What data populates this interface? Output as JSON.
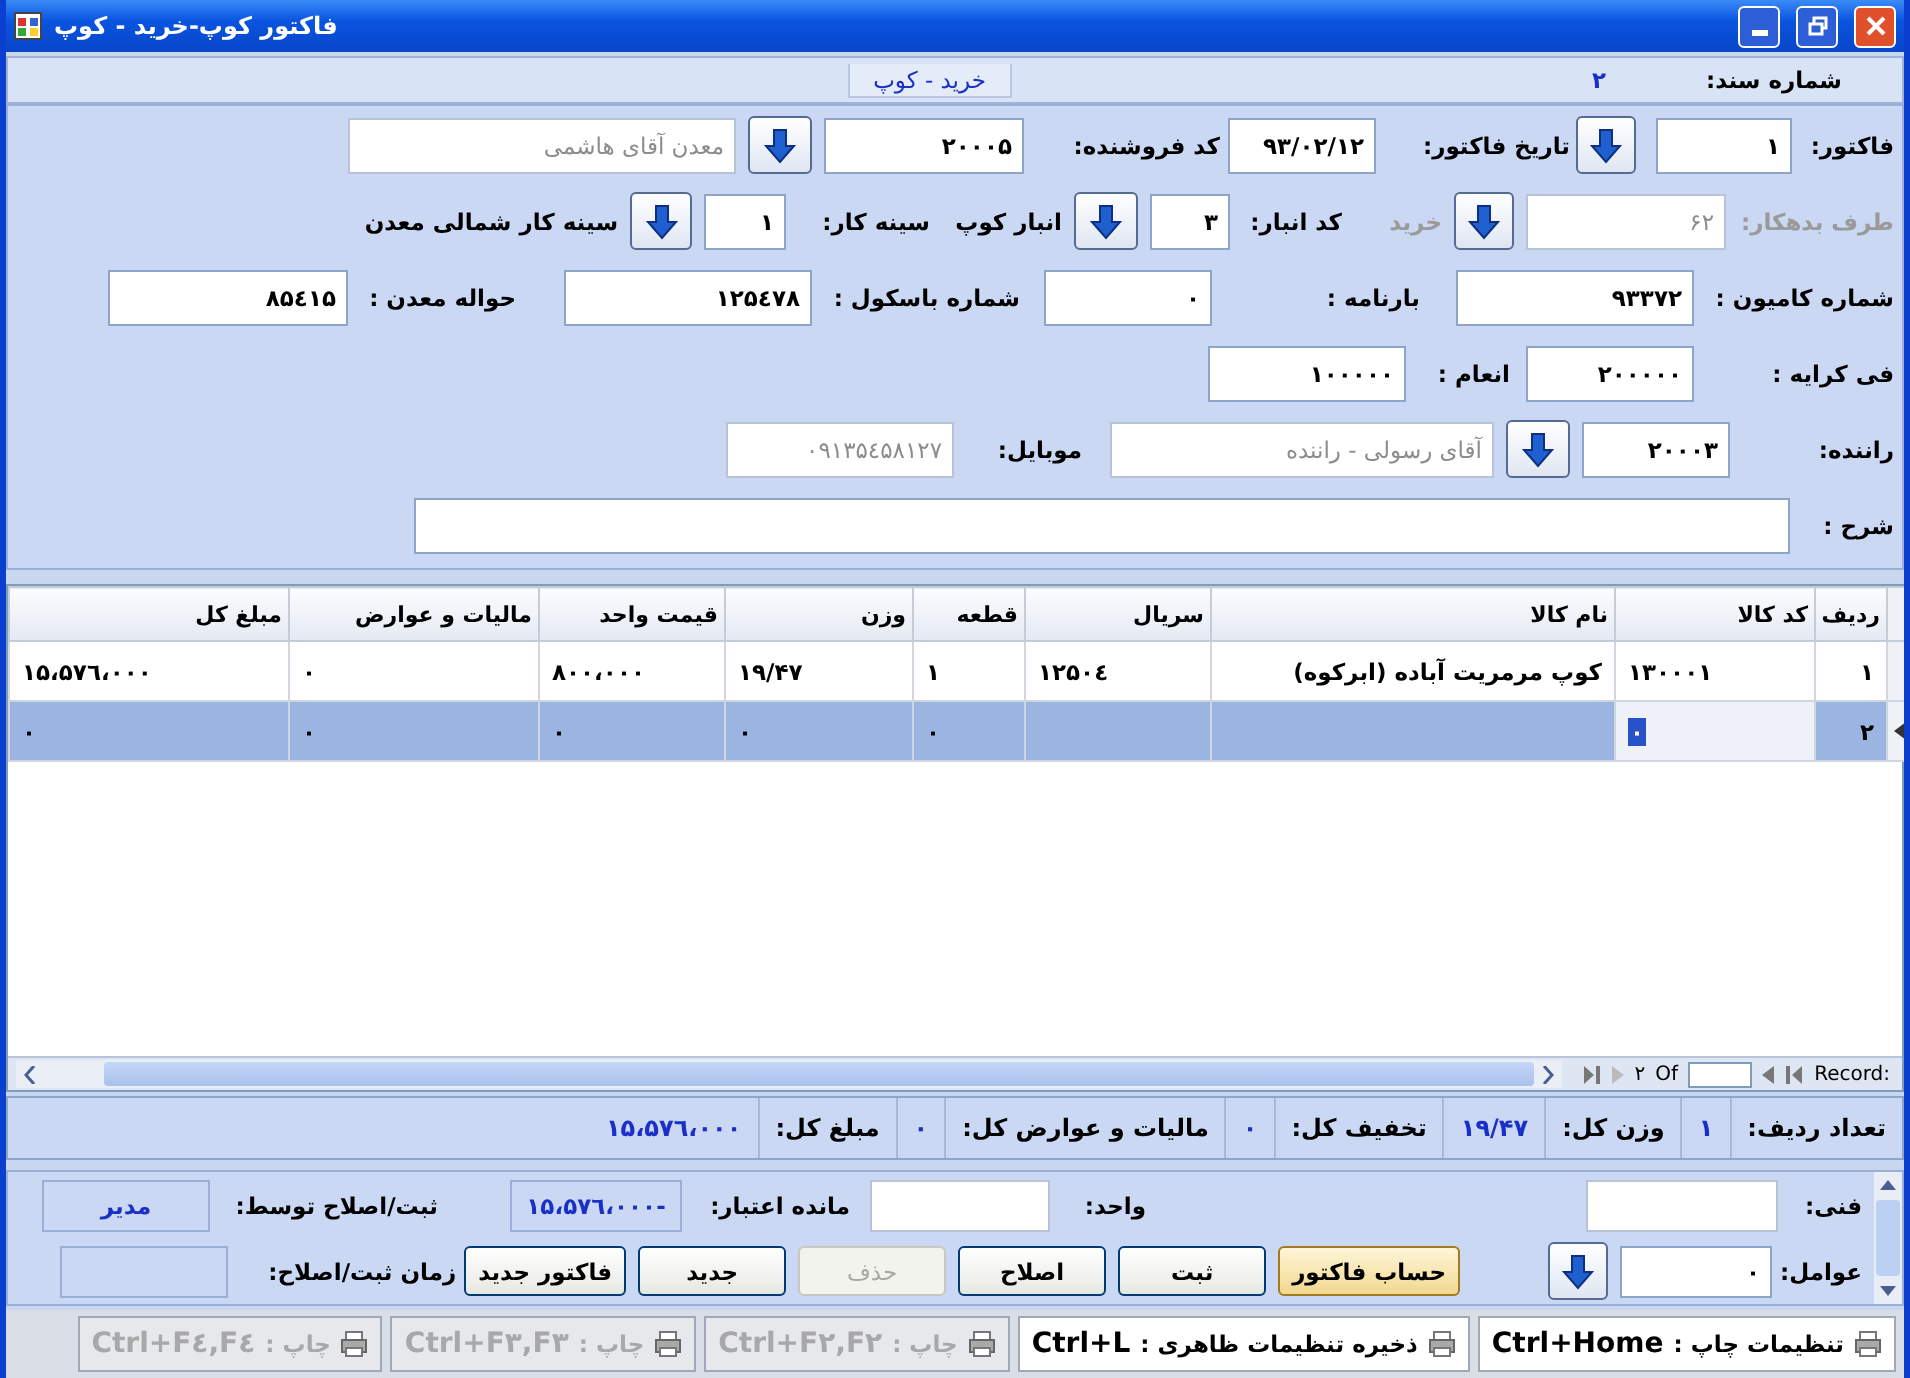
{
  "window": {
    "title": "فاکتور کوپ-خرید - کوپ"
  },
  "header": {
    "doc_label": "شماره سند:",
    "doc_number": "۲",
    "tab": "خرید - کوپ"
  },
  "form_rows": [
    [
      {
        "kind": "label",
        "text": "فاکتور:",
        "disabled": false
      },
      {
        "kind": "field",
        "value": "۱",
        "disabled": false
      },
      {
        "kind": "button"
      },
      {
        "kind": "label",
        "text": "تاریخ فاکتور:",
        "disabled": false
      },
      {
        "kind": "field",
        "value": "۹۳/۰۲/۱۲",
        "disabled": false
      },
      {
        "kind": "label",
        "text": "کد فروشنده:",
        "disabled": false
      },
      {
        "kind": "field",
        "value": "۲۰۰۰۵",
        "disabled": false
      },
      {
        "kind": "button"
      },
      {
        "kind": "field",
        "value": "معدن آقای هاشمی",
        "disabled": true
      }
    ],
    [
      {
        "kind": "label",
        "text": "طرف بدهکار:",
        "disabled": true
      },
      {
        "kind": "field",
        "value": "۶۲",
        "disabled": true
      },
      {
        "kind": "button"
      },
      {
        "kind": "label",
        "text": "خرید",
        "disabled": true
      },
      {
        "kind": "label",
        "text": "کد انبار:",
        "disabled": false
      },
      {
        "kind": "field",
        "value": "۳",
        "disabled": false
      },
      {
        "kind": "button"
      },
      {
        "kind": "label",
        "text": "انبار کوپ",
        "disabled": false
      },
      {
        "kind": "label",
        "text": "سینه کار:",
        "disabled": false
      },
      {
        "kind": "field",
        "value": "۱",
        "disabled": false
      },
      {
        "kind": "button"
      },
      {
        "kind": "label",
        "text": "سینه کار شمالی معدن",
        "disabled": false
      }
    ],
    [
      {
        "kind": "label",
        "text": "شماره کامیون :",
        "disabled": false
      },
      {
        "kind": "field",
        "value": "۹۳۳۷۲",
        "disabled": false
      },
      {
        "kind": "label",
        "text": "بارنامه :",
        "disabled": false
      },
      {
        "kind": "field",
        "value": "۰",
        "disabled": false
      },
      {
        "kind": "label",
        "text": "شماره باسکول :",
        "disabled": false
      },
      {
        "kind": "field",
        "value": "۱۲۵٤۷۸",
        "disabled": false
      },
      {
        "kind": "label",
        "text": "حواله معدن :",
        "disabled": false
      },
      {
        "kind": "field",
        "value": "۸۵٤۱۵",
        "disabled": false
      }
    ],
    [
      {
        "kind": "label",
        "text": "فی کرایه :",
        "disabled": false
      },
      {
        "kind": "field",
        "value": "۲۰۰۰۰۰",
        "disabled": false
      },
      {
        "kind": "label",
        "text": "انعام :",
        "disabled": false
      },
      {
        "kind": "field",
        "value": "۱۰۰۰۰۰",
        "disabled": false
      }
    ],
    [
      {
        "kind": "label",
        "text": "راننده:",
        "disabled": false
      },
      {
        "kind": "field",
        "value": "۲۰۰۰۳",
        "disabled": false
      },
      {
        "kind": "button"
      },
      {
        "kind": "field",
        "value": "آقای رسولی - راننده",
        "disabled": true
      },
      {
        "kind": "label",
        "text": "موبایل:",
        "disabled": false
      },
      {
        "kind": "field",
        "value": "۰۹۱۳۵٤۵۸۱۲۷",
        "disabled": true
      }
    ],
    [
      {
        "kind": "label",
        "text": "شرح :",
        "disabled": false
      },
      {
        "kind": "field",
        "disabled": false
      }
    ]
  ],
  "table": {
    "columns": [
      "ردیف",
      "کد کالا",
      "نام کالا",
      "سریال",
      "قطعه",
      "وزن",
      "قیمت واحد",
      "مالیات و عوارض",
      "مبلغ کل"
    ],
    "rows": [
      {
        "selected": false,
        "cells": [
          {
            "text": "۱",
            "focused": false
          },
          {
            "text": "۱۳۰۰۰۱",
            "focused": false
          },
          {
            "text": "کوپ مرمریت آباده (ابرکوه)",
            "focused": false
          },
          {
            "text": "۱۲۵۰٤",
            "focused": false
          },
          {
            "text": "۱",
            "focused": false
          },
          {
            "text": "۱۹/۴۷",
            "focused": false
          },
          {
            "text": "۸۰۰،۰۰۰",
            "focused": false
          },
          {
            "text": "۰",
            "focused": false
          },
          {
            "text": "۱۵،۵۷٦،۰۰۰",
            "focused": false
          }
        ]
      },
      {
        "selected": true,
        "cells": [
          {
            "text": "۲",
            "focused": false
          },
          {
            "text": "۰",
            "focused": true
          },
          {
            "focused": false
          },
          {
            "focused": false
          },
          {
            "text": "۰",
            "focused": false
          },
          {
            "text": "۰",
            "focused": false
          },
          {
            "text": "۰",
            "focused": false
          },
          {
            "text": "۰",
            "focused": false
          },
          {
            "text": "۰",
            "focused": false
          }
        ]
      }
    ]
  },
  "record_nav": {
    "label": "Record:",
    "of": "Of",
    "total": "۲"
  },
  "summary": [
    {
      "label": "تعداد ردیف:",
      "value": "۱"
    },
    {
      "label": "وزن کل:",
      "value": "۱۹/۴۷"
    },
    {
      "label": "تخفیف کل:",
      "value": "۰"
    },
    {
      "label": "مالیات و عوارض کل:",
      "value": "۰"
    },
    {
      "label": "مبلغ کل:",
      "value": "۱۵،۵۷٦،۰۰۰"
    }
  ],
  "bottom": {
    "technical": {
      "label": "فنی:"
    },
    "unit": {
      "label": "واحد:"
    },
    "credit": {
      "label": "مانده اعتبار:",
      "value": "۱۵،۵۷٦،۰۰۰-"
    },
    "by": {
      "label": "ثبت/اصلاح توسط:",
      "value": "مدیر"
    },
    "agents": {
      "label": "عوامل:",
      "value": "۰"
    },
    "time": {
      "label": "زمان ثبت/اصلاح:"
    },
    "buttons": [
      {
        "label": "حساب فاکتور",
        "disabled": false,
        "highlighted": true
      },
      {
        "label": "ثبت",
        "disabled": false,
        "highlighted": false
      },
      {
        "label": "اصلاح",
        "disabled": false,
        "highlighted": false
      },
      {
        "label": "حذف",
        "disabled": true,
        "highlighted": false
      },
      {
        "label": "جدید",
        "disabled": false,
        "highlighted": false
      },
      {
        "label": "فاکتور جدید",
        "disabled": false,
        "highlighted": false
      }
    ]
  },
  "toolbar": [
    {
      "label": "تنظیمات چاپ :",
      "shortcut": "Ctrl+Home",
      "disabled": false
    },
    {
      "label": "ذخیره تنظیمات ظاهری :",
      "shortcut": "Ctrl+L",
      "disabled": false
    },
    {
      "label": "چاپ :",
      "shortcut": "Ctrl+F۲,F۲",
      "disabled": true
    },
    {
      "label": "چاپ :",
      "shortcut": "Ctrl+F۳,F۳",
      "disabled": true
    },
    {
      "label": "چاپ :",
      "shortcut": "Ctrl+F٤,F٤",
      "disabled": true
    }
  ]
}
